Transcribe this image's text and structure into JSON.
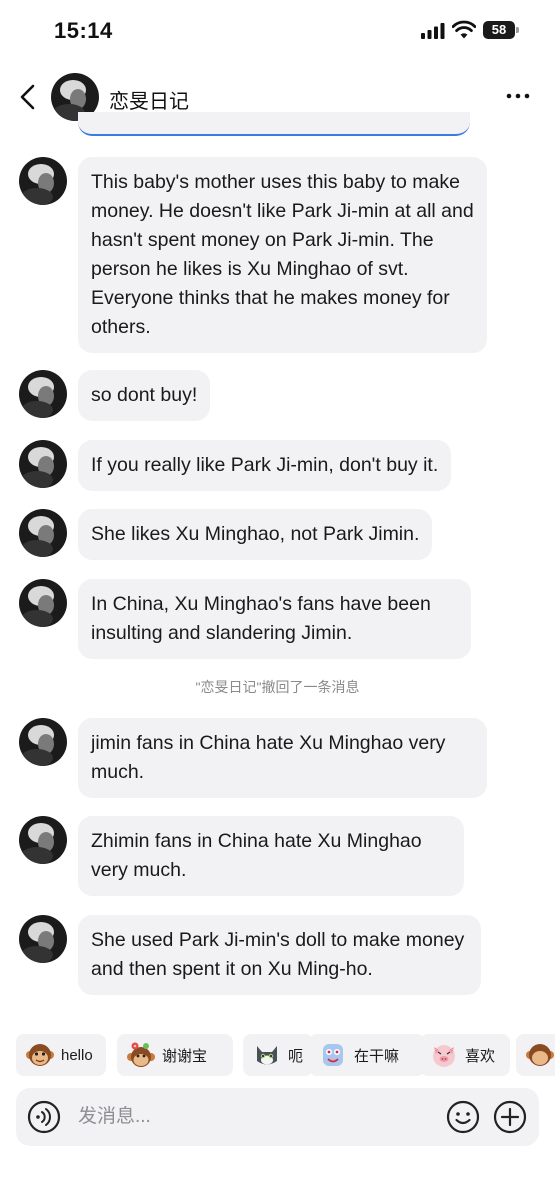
{
  "status_bar": {
    "time": "15:14",
    "battery": "58",
    "icons": [
      "signal-icon",
      "wifi-icon",
      "battery-icon"
    ]
  },
  "header": {
    "title": "恋旻日记",
    "back_icon": "chevron-left-icon",
    "more_icon": "more-horizontal-icon"
  },
  "messages": [
    {
      "text": "This baby's mother uses this baby to make money. He doesn't like Park Ji-min at all and hasn't spent money on Park Ji-min. The person he likes is Xu Minghao of svt. Everyone thinks that he makes money for others."
    },
    {
      "text": "so dont buy!"
    },
    {
      "text": "If you really like Park Ji-min, don't buy it."
    },
    {
      "text": "She likes Xu Minghao, not Park Jimin."
    },
    {
      "text": "In China, Xu Minghao's fans have been insulting and slandering Jimin."
    },
    {
      "text": "jimin fans in China hate Xu Minghao very much."
    },
    {
      "text": "Zhimin fans in China hate Xu Minghao very much."
    },
    {
      "text": "She used Park Ji-min's doll to make money and then spent it on Xu Ming-ho."
    }
  ],
  "recall_notice": "\"恋旻日记\"撤回了一条消息",
  "quick_replies": [
    {
      "label": "hello",
      "icon": "monkey-emoji-icon"
    },
    {
      "label": "谢谢宝",
      "icon": "monkey-flower-emoji-icon"
    },
    {
      "label": "呃",
      "icon": "cat-emoji-icon"
    },
    {
      "label": "在干嘛",
      "icon": "creature-emoji-icon"
    },
    {
      "label": "喜欢",
      "icon": "pig-emoji-icon"
    },
    {
      "label": "",
      "icon": "monkey-emoji-icon"
    }
  ],
  "input": {
    "placeholder": "发消息...",
    "value": "",
    "voice_icon": "voice-icon",
    "emoji_icon": "smiley-icon",
    "plus_icon": "plus-icon"
  },
  "colors": {
    "bubble": "#f2f2f4",
    "text": "#1a1a1a",
    "muted": "#8a8a8e",
    "accent_line": "#3d7be0"
  }
}
